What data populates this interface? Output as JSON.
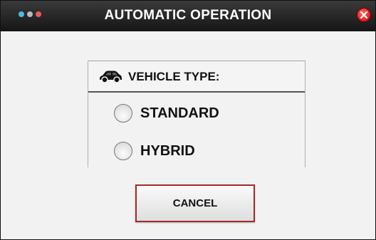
{
  "window": {
    "title": "AUTOMATIC OPERATION",
    "dot_colors": [
      "#4fb8e8",
      "#b9b9b9",
      "#e85c5c"
    ],
    "close_color": "#e01b1b",
    "close_icon": "close-icon"
  },
  "panel": {
    "icon": "car-icon",
    "title": "VEHICLE TYPE:",
    "options": [
      {
        "label": "STANDARD",
        "selected": false
      },
      {
        "label": "HYBRID",
        "selected": false
      }
    ]
  },
  "buttons": {
    "cancel_label": "CANCEL",
    "cancel_border_color": "#a52a2a"
  }
}
